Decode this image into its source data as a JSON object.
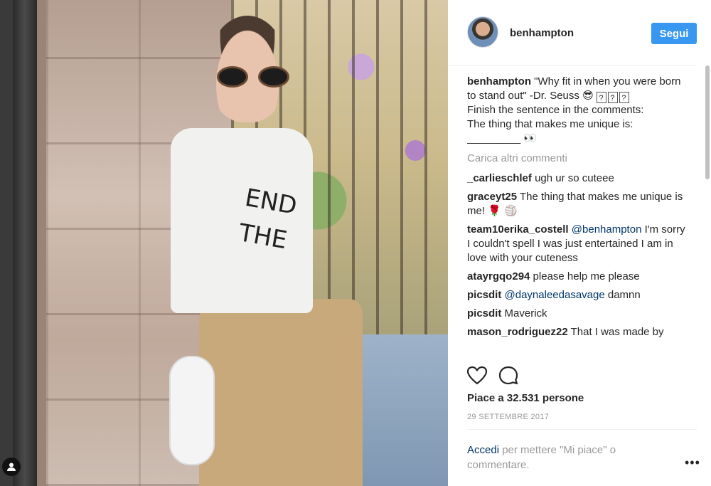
{
  "photo": {
    "shirt_text": "END THE",
    "alt": "user-tag"
  },
  "header": {
    "username": "benhampton",
    "follow_label": "Segui"
  },
  "caption": {
    "username": "benhampton",
    "line1": "\"Why fit in when you were born to stand out\" -Dr. Seuss 😎",
    "line2": "Finish the sentence in the comments:",
    "line3": "The thing that makes me unique is:",
    "line4": "_________ 👀",
    "box_glyph": "?"
  },
  "load_more": "Carica altri commenti",
  "comments": [
    {
      "user": "_carlieschlef",
      "text": "ugh ur so cuteee",
      "mention": ""
    },
    {
      "user": "graceyt25",
      "text": "The thing that makes me unique is me! 🌹 🏐",
      "mention": ""
    },
    {
      "user": "team10erika_costell",
      "mention": "@benhampton",
      "text": "I'm sorry I couldn't spell I was just entertained I am in love with your cuteness"
    },
    {
      "user": "atayrgqo294",
      "text": "please help me please",
      "mention": ""
    },
    {
      "user": "picsdit",
      "mention": "@daynaleedasavage",
      "text": "damnn"
    },
    {
      "user": "picsdit",
      "text": "Maverick",
      "mention": ""
    },
    {
      "user": "mason_rodriguez22",
      "text": "That I was made by",
      "mention": ""
    }
  ],
  "likes": "Piace a 32.531 persone",
  "date": "29 SETTEMBRE 2017",
  "login": {
    "link": "Accedi",
    "text": " per mettere \"Mi piace\" o commentare."
  },
  "more_label": "•••",
  "icons": [
    "heart-icon",
    "comment-icon",
    "more-options-icon",
    "user-tag-icon"
  ]
}
